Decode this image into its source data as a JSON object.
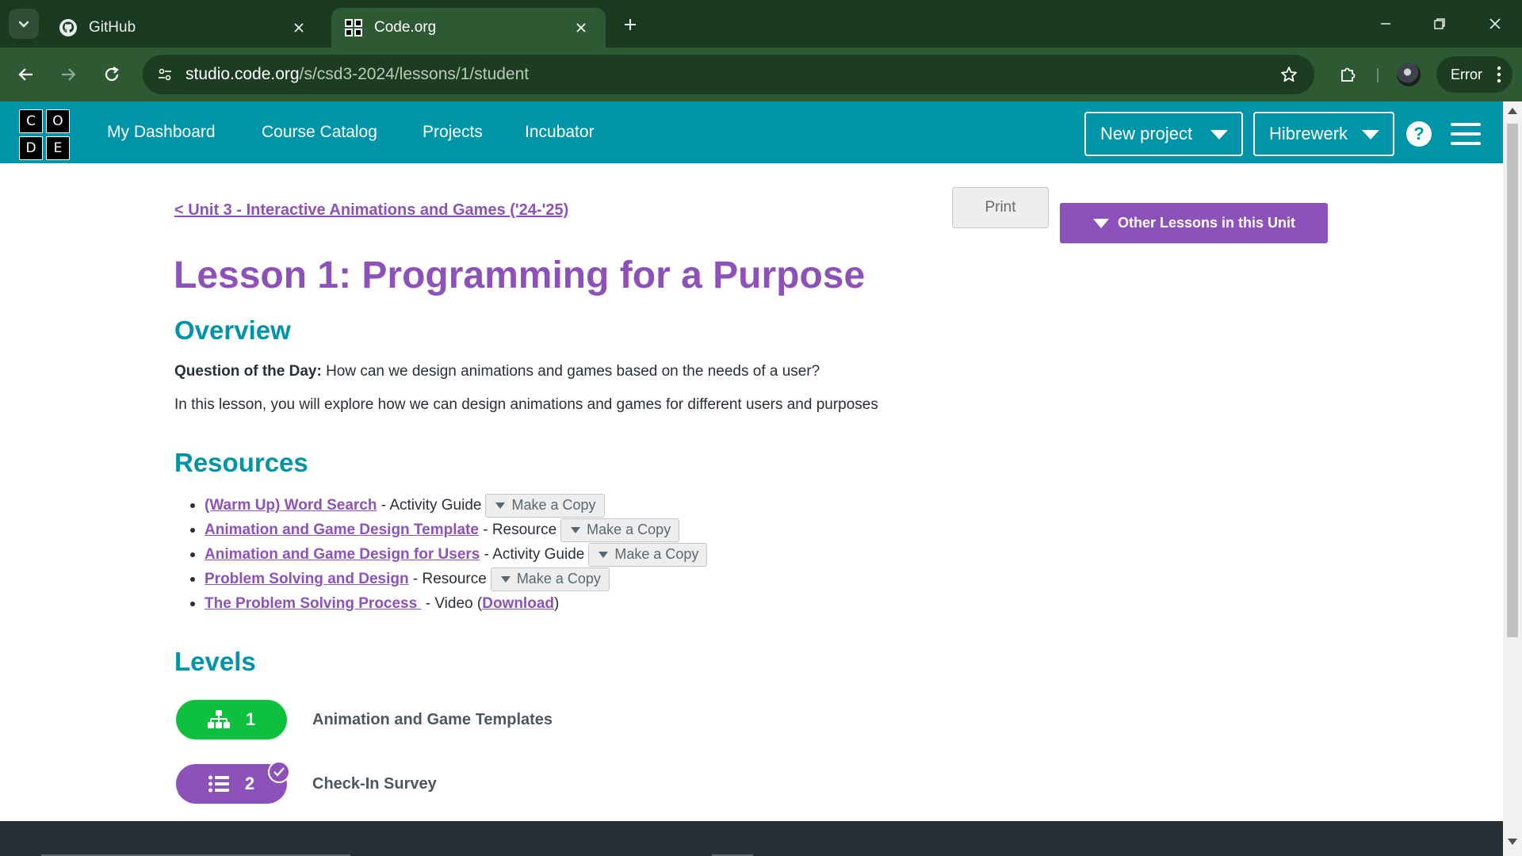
{
  "browser": {
    "tabs": [
      {
        "title": "GitHub",
        "icon": "github-icon",
        "active": false
      },
      {
        "title": "Code.org",
        "icon": "codeorg-icon",
        "active": true
      }
    ],
    "url_host": "studio.code.org",
    "url_path": "/s/csd3-2024/lessons/1/student",
    "profile_status": "Error"
  },
  "header": {
    "logo_letters": [
      "C",
      "O",
      "D",
      "E"
    ],
    "nav": [
      "My Dashboard",
      "Course Catalog",
      "Projects",
      "Incubator"
    ],
    "new_project": "New project",
    "user_menu": "Hibrewerk",
    "help": "?"
  },
  "lesson": {
    "unit_link": "< Unit 3 - Interactive Animations and Games ('24-'25)",
    "print": "Print",
    "other_lessons": "Other Lessons in this Unit",
    "title": "Lesson 1: Programming for a Purpose",
    "overview_heading": "Overview",
    "qotd_label": "Question of the Day:",
    "qotd_text": " How can we design animations and games based on the needs of a user?",
    "overview_text": "In this lesson, you will explore how we can design animations and games for different users and purposes",
    "resources_heading": "Resources",
    "resources": [
      {
        "link": "(Warm Up) Word Search",
        "type": " - Activity Guide",
        "action": "Make a Copy"
      },
      {
        "link": "Animation and Game Design Template",
        "type": " - Resource",
        "action": "Make a Copy"
      },
      {
        "link": "Animation and Game Design for Users",
        "type": " - Activity Guide",
        "action": "Make a Copy"
      },
      {
        "link": "Problem Solving and Design",
        "type": " - Resource",
        "action": "Make a Copy"
      },
      {
        "link": "The Problem Solving Process ",
        "type": " - Video (",
        "download": "Download",
        "close": ")"
      }
    ],
    "levels_heading": "Levels",
    "levels": [
      {
        "number": "1",
        "name": "Animation and Game Templates",
        "icon": "sitemap-icon",
        "color": "#0fbf3e"
      },
      {
        "number": "2",
        "name": "Check-In Survey",
        "icon": "list-icon",
        "color": "#8c52ba",
        "completed": true
      }
    ]
  },
  "colors": {
    "accent_purple": "#8c52ba",
    "accent_teal": "#0094a8",
    "chrome_green": "#2d5a33"
  }
}
